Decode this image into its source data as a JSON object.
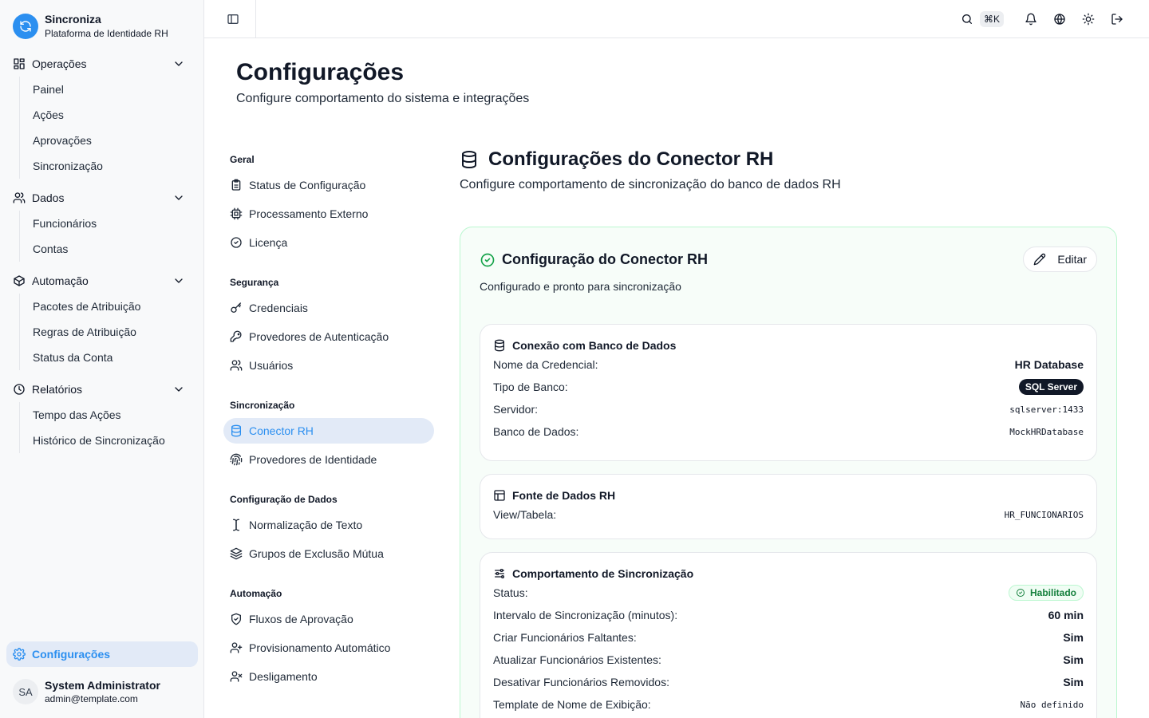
{
  "brand": {
    "name": "Sincroniza",
    "subtitle": "Plataforma de Identidade RH"
  },
  "sidebar": {
    "groups": [
      {
        "label": "Operações",
        "items": [
          "Painel",
          "Ações",
          "Aprovações",
          "Sincronização"
        ]
      },
      {
        "label": "Dados",
        "items": [
          "Funcionários",
          "Contas"
        ]
      },
      {
        "label": "Automação",
        "items": [
          "Pacotes de Atribuição",
          "Regras de Atribuição",
          "Status da Conta"
        ]
      },
      {
        "label": "Relatórios",
        "items": [
          "Tempo das Ações",
          "Histórico de Sincronização"
        ]
      }
    ],
    "settings_label": "Configurações"
  },
  "user": {
    "initials": "SA",
    "name": "System Administrator",
    "email": "admin@template.com"
  },
  "topbar": {
    "shortcut": "⌘K"
  },
  "page": {
    "title": "Configurações",
    "subtitle": "Configure comportamento do sistema e integrações"
  },
  "subnav": {
    "sections": [
      {
        "title": "Geral",
        "items": [
          "Status de Configuração",
          "Processamento Externo",
          "Licença"
        ]
      },
      {
        "title": "Segurança",
        "items": [
          "Credenciais",
          "Provedores de Autenticação",
          "Usuários"
        ]
      },
      {
        "title": "Sincronização",
        "items": [
          "Conector RH",
          "Provedores de Identidade"
        ]
      },
      {
        "title": "Configuração de Dados",
        "items": [
          "Normalização de Texto",
          "Grupos de Exclusão Mútua"
        ]
      },
      {
        "title": "Automação",
        "items": [
          "Fluxos de Aprovação",
          "Provisionamento Automático",
          "Desligamento"
        ]
      }
    ]
  },
  "content": {
    "title": "Configurações do Conector RH",
    "subtitle": "Configure comportamento de sincronização do banco de dados RH",
    "card": {
      "title": "Configuração do Conector RH",
      "subtitle": "Configurado e pronto para sincronização",
      "edit_label": "Editar",
      "db": {
        "title": "Conexão com Banco de Dados",
        "credential_label": "Nome da Credencial:",
        "credential_value": "HR Database",
        "type_label": "Tipo de Banco:",
        "type_value": "SQL Server",
        "server_label": "Servidor:",
        "server_value": "sqlserver:1433",
        "database_label": "Banco de Dados:",
        "database_value": "MockHRDatabase"
      },
      "source": {
        "title": "Fonte de Dados RH",
        "view_label": "View/Tabela:",
        "view_value": "HR_FUNCIONARIOS"
      },
      "sync": {
        "title": "Comportamento de Sincronização",
        "status_label": "Status:",
        "status_value": "Habilitado",
        "interval_label": "Intervalo de Sincronização (minutos):",
        "interval_value": "60 min",
        "create_label": "Criar Funcionários Faltantes:",
        "create_value": "Sim",
        "update_label": "Atualizar Funcionários Existentes:",
        "update_value": "Sim",
        "deactivate_label": "Desativar Funcionários Removidos:",
        "deactivate_value": "Sim",
        "template_label": "Template de Nome de Exibição:",
        "template_value": "Não definido"
      }
    }
  },
  "colors": {
    "accent": "#2b8ff0",
    "success": "#16a34a",
    "active_bg": "#e2eaf7"
  }
}
